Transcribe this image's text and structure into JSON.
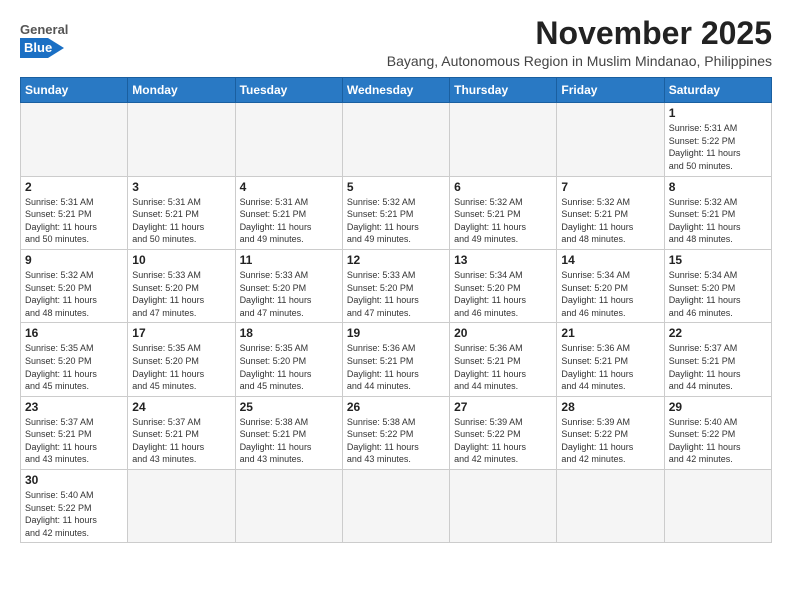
{
  "header": {
    "logo_general": "General",
    "logo_blue": "Blue",
    "month_title": "November 2025",
    "location": "Bayang, Autonomous Region in Muslim Mindanao, Philippines"
  },
  "weekdays": [
    "Sunday",
    "Monday",
    "Tuesday",
    "Wednesday",
    "Thursday",
    "Friday",
    "Saturday"
  ],
  "weeks": [
    [
      {
        "day": "",
        "info": ""
      },
      {
        "day": "",
        "info": ""
      },
      {
        "day": "",
        "info": ""
      },
      {
        "day": "",
        "info": ""
      },
      {
        "day": "",
        "info": ""
      },
      {
        "day": "",
        "info": ""
      },
      {
        "day": "1",
        "info": "Sunrise: 5:31 AM\nSunset: 5:22 PM\nDaylight: 11 hours\nand 50 minutes."
      }
    ],
    [
      {
        "day": "2",
        "info": "Sunrise: 5:31 AM\nSunset: 5:21 PM\nDaylight: 11 hours\nand 50 minutes."
      },
      {
        "day": "3",
        "info": "Sunrise: 5:31 AM\nSunset: 5:21 PM\nDaylight: 11 hours\nand 50 minutes."
      },
      {
        "day": "4",
        "info": "Sunrise: 5:31 AM\nSunset: 5:21 PM\nDaylight: 11 hours\nand 49 minutes."
      },
      {
        "day": "5",
        "info": "Sunrise: 5:32 AM\nSunset: 5:21 PM\nDaylight: 11 hours\nand 49 minutes."
      },
      {
        "day": "6",
        "info": "Sunrise: 5:32 AM\nSunset: 5:21 PM\nDaylight: 11 hours\nand 49 minutes."
      },
      {
        "day": "7",
        "info": "Sunrise: 5:32 AM\nSunset: 5:21 PM\nDaylight: 11 hours\nand 48 minutes."
      },
      {
        "day": "8",
        "info": "Sunrise: 5:32 AM\nSunset: 5:21 PM\nDaylight: 11 hours\nand 48 minutes."
      }
    ],
    [
      {
        "day": "9",
        "info": "Sunrise: 5:32 AM\nSunset: 5:20 PM\nDaylight: 11 hours\nand 48 minutes."
      },
      {
        "day": "10",
        "info": "Sunrise: 5:33 AM\nSunset: 5:20 PM\nDaylight: 11 hours\nand 47 minutes."
      },
      {
        "day": "11",
        "info": "Sunrise: 5:33 AM\nSunset: 5:20 PM\nDaylight: 11 hours\nand 47 minutes."
      },
      {
        "day": "12",
        "info": "Sunrise: 5:33 AM\nSunset: 5:20 PM\nDaylight: 11 hours\nand 47 minutes."
      },
      {
        "day": "13",
        "info": "Sunrise: 5:34 AM\nSunset: 5:20 PM\nDaylight: 11 hours\nand 46 minutes."
      },
      {
        "day": "14",
        "info": "Sunrise: 5:34 AM\nSunset: 5:20 PM\nDaylight: 11 hours\nand 46 minutes."
      },
      {
        "day": "15",
        "info": "Sunrise: 5:34 AM\nSunset: 5:20 PM\nDaylight: 11 hours\nand 46 minutes."
      }
    ],
    [
      {
        "day": "16",
        "info": "Sunrise: 5:35 AM\nSunset: 5:20 PM\nDaylight: 11 hours\nand 45 minutes."
      },
      {
        "day": "17",
        "info": "Sunrise: 5:35 AM\nSunset: 5:20 PM\nDaylight: 11 hours\nand 45 minutes."
      },
      {
        "day": "18",
        "info": "Sunrise: 5:35 AM\nSunset: 5:20 PM\nDaylight: 11 hours\nand 45 minutes."
      },
      {
        "day": "19",
        "info": "Sunrise: 5:36 AM\nSunset: 5:21 PM\nDaylight: 11 hours\nand 44 minutes."
      },
      {
        "day": "20",
        "info": "Sunrise: 5:36 AM\nSunset: 5:21 PM\nDaylight: 11 hours\nand 44 minutes."
      },
      {
        "day": "21",
        "info": "Sunrise: 5:36 AM\nSunset: 5:21 PM\nDaylight: 11 hours\nand 44 minutes."
      },
      {
        "day": "22",
        "info": "Sunrise: 5:37 AM\nSunset: 5:21 PM\nDaylight: 11 hours\nand 44 minutes."
      }
    ],
    [
      {
        "day": "23",
        "info": "Sunrise: 5:37 AM\nSunset: 5:21 PM\nDaylight: 11 hours\nand 43 minutes."
      },
      {
        "day": "24",
        "info": "Sunrise: 5:37 AM\nSunset: 5:21 PM\nDaylight: 11 hours\nand 43 minutes."
      },
      {
        "day": "25",
        "info": "Sunrise: 5:38 AM\nSunset: 5:21 PM\nDaylight: 11 hours\nand 43 minutes."
      },
      {
        "day": "26",
        "info": "Sunrise: 5:38 AM\nSunset: 5:22 PM\nDaylight: 11 hours\nand 43 minutes."
      },
      {
        "day": "27",
        "info": "Sunrise: 5:39 AM\nSunset: 5:22 PM\nDaylight: 11 hours\nand 42 minutes."
      },
      {
        "day": "28",
        "info": "Sunrise: 5:39 AM\nSunset: 5:22 PM\nDaylight: 11 hours\nand 42 minutes."
      },
      {
        "day": "29",
        "info": "Sunrise: 5:40 AM\nSunset: 5:22 PM\nDaylight: 11 hours\nand 42 minutes."
      }
    ],
    [
      {
        "day": "30",
        "info": "Sunrise: 5:40 AM\nSunset: 5:22 PM\nDaylight: 11 hours\nand 42 minutes."
      },
      {
        "day": "",
        "info": ""
      },
      {
        "day": "",
        "info": ""
      },
      {
        "day": "",
        "info": ""
      },
      {
        "day": "",
        "info": ""
      },
      {
        "day": "",
        "info": ""
      },
      {
        "day": "",
        "info": ""
      }
    ]
  ]
}
